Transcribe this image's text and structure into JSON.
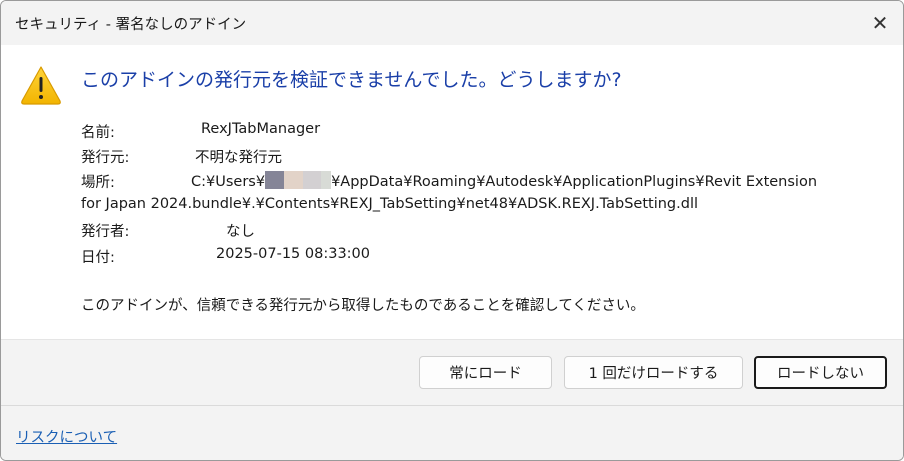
{
  "window": {
    "title": "セキュリティ - 署名なしのアドイン"
  },
  "heading": "このアドインの発行元を検証できませんでした。どうしますか?",
  "details": {
    "name_label": "名前:",
    "name_value": "RexJTabManager",
    "publisher_label": "発行元:",
    "publisher_value": "不明な発行元",
    "location_label": "場所:",
    "location_prefix": "C:¥Users¥",
    "location_suffix": "¥AppData¥Roaming¥Autodesk¥ApplicationPlugins¥Revit Extension",
    "location_line2": "for Japan 2024.bundle¥.¥Contents¥REXJ_TabSetting¥net48¥ADSK.REXJ.TabSetting.dll",
    "issuer_label": "発行者:",
    "issuer_value": "なし",
    "date_label": "日付:",
    "date_value": "2025-07-15 08:33:00"
  },
  "confirm_text": "このアドインが、信頼できる発行元から取得したものであることを確認してください。",
  "buttons": {
    "always": "常にロード",
    "once": "1 回だけロードする",
    "no": "ロードしない"
  },
  "footer": {
    "link": "リスクについて"
  },
  "colors": {
    "heading": "#1a3fa8",
    "link": "#1a5fb4",
    "redact": [
      "#858597",
      "#e2d3c8",
      "#d3d0d2",
      "#d8dbd6"
    ]
  }
}
